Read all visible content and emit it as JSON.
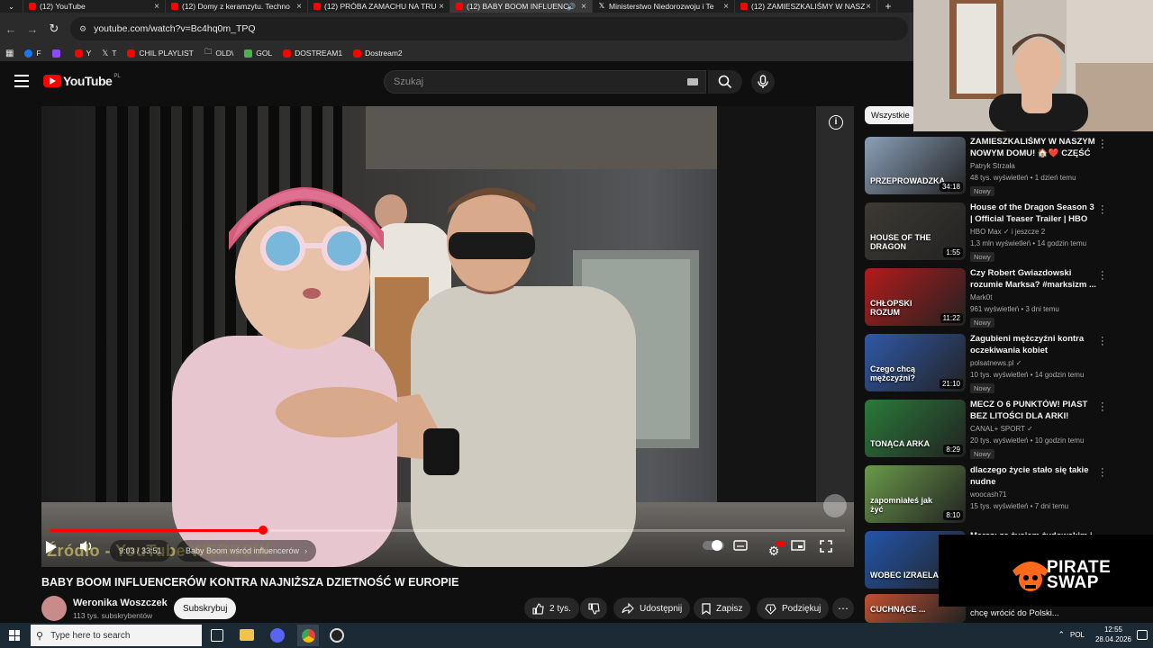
{
  "browser": {
    "tabs": [
      {
        "label": "(12) YouTube",
        "icon": "youtube-icon"
      },
      {
        "label": "(12) Domy z keramzytu. Techno",
        "icon": "youtube-icon"
      },
      {
        "label": "(12) PRÓBA ZAMACHU NA TRU",
        "icon": "youtube-icon"
      },
      {
        "label": "(12) BABY BOOM INFLUENC",
        "icon": "youtube-icon",
        "active": true
      },
      {
        "label": "Ministerstwo Niedorozwoju i Te",
        "icon": "x-icon"
      },
      {
        "label": "(12) ZAMIESZKALIŚMY W NASZ",
        "icon": "youtube-icon"
      }
    ],
    "new_tab": "+",
    "url": "youtube.com/watch?v=Bc4hq0m_TPQ",
    "bookmarks": [
      {
        "label": "F",
        "color": "#1877f2"
      },
      {
        "label": "Y",
        "color": "#ff0000"
      },
      {
        "label": "T",
        "color": "#ffffff"
      },
      {
        "label": "CHIL PLAYLIST",
        "color": "#ff0000"
      },
      {
        "label": "OLD\\",
        "color": "#9e9e9e"
      },
      {
        "label": "GOL",
        "color": "#4caf50"
      },
      {
        "label": "DOSTREAM1",
        "color": "#ff0000"
      },
      {
        "label": "Dostream2",
        "color": "#ff0000"
      }
    ]
  },
  "youtube": {
    "logo_text": "YouTube",
    "logo_region": "PL",
    "search_placeholder": "Szukaj"
  },
  "player": {
    "current_time": "9:03",
    "duration": "33:51",
    "time_display": "9:03 / 33:51",
    "chapter": "Baby Boom wśród influencerów",
    "watermark": "Źródło - YouTube WERSOW",
    "progress": 0.268
  },
  "video": {
    "title": "BABY BOOM INFLUENCERÓW KONTRA NAJNIŻSZA DZIETNOŚĆ W EUROPIE",
    "channel": "Weronika Woszczek",
    "subscribers": "113 tys. subskrybentów",
    "subscribe_label": "Subskrybuj",
    "likes": "2 tys.",
    "share_label": "Udostępnij",
    "save_label": "Zapisz",
    "thanks_label": "Podziękuj",
    "more": "⋯"
  },
  "sidebar": {
    "chip": "Wszystkie",
    "items": [
      {
        "title": "ZAMIESZKALIŚMY W NASZYM NOWYM DOMU! 🏠❤️ CZĘŚĆ ...",
        "channel": "Patryk Strzała",
        "meta": "48 tys. wyświetleń • 1 dzień temu",
        "badge": "Nowy",
        "duration": "34:18",
        "thumb_color": "#8aa0b8",
        "thumb_text": "PRZEPROWADZKA"
      },
      {
        "title": "House of the Dragon Season 3 | Official Teaser Trailer | HBO ...",
        "channel": "HBO Max ✓ i jeszcze 2",
        "meta": "1,3 mln wyświetleń • 14 godzin temu",
        "badge": "Nowy",
        "duration": "1:55",
        "thumb_color": "#3d3a34",
        "thumb_text": "HOUSE OF THE DRAGON"
      },
      {
        "title": "Czy Robert Gwiazdowski rozumie Marksa? #marksizm ...",
        "channel": "Mark0t",
        "meta": "961 wyświetleń • 3 dni temu",
        "badge": "Nowy",
        "duration": "11:22",
        "thumb_color": "#b31b1b",
        "thumb_text": "CHŁOPSKI ROZUM"
      },
      {
        "title": "Zagubieni mężczyźni kontra oczekiwania kobiet",
        "channel": "polsatnews.pl ✓",
        "meta": "10 tys. wyświetleń • 14 godzin temu",
        "badge": "Nowy",
        "duration": "21:10",
        "thumb_color": "#3058a8",
        "thumb_text": "Czego chcą mężczyźni?"
      },
      {
        "title": "MECZ O 6 PUNKTÓW! PIAST BEZ LITOŚCI DLA ARKI! PIAST...",
        "channel": "CANAL+ SPORT ✓",
        "meta": "20 tys. wyświetleń • 10 godzin temu",
        "badge": "Nowy",
        "duration": "8:29",
        "thumb_color": "#2a7a3a",
        "thumb_text": "TONĄCA ARKA"
      },
      {
        "title": "dlaczego życie stało się takie nudne",
        "channel": "woocash71",
        "meta": "15 tys. wyświetleń • 7 dni temu",
        "badge": "",
        "duration": "8:10",
        "thumb_color": "#6a9a4a",
        "thumb_text": "zapomniałeś jak żyć"
      },
      {
        "title": "Marsz: za życiem żydowskim i ...",
        "channel": "",
        "meta": "",
        "badge": "",
        "duration": "",
        "thumb_color": "#2255aa",
        "thumb_text": "WOBEC IZRAELA"
      },
      {
        "title": "chcę wrócić do Polski...",
        "channel": "",
        "meta": "",
        "badge": "",
        "duration": "",
        "thumb_color": "#c05030",
        "thumb_text": "CUCHNĄCE ..."
      }
    ]
  },
  "overlay": {
    "brand": "PIRATE SWAP",
    "brand_line1": "PIRATE",
    "brand_line2": "SWAP"
  },
  "taskbar": {
    "search_placeholder": "Type here to search",
    "lang": "POL",
    "time": "12:55",
    "date": "28.04.2026"
  }
}
